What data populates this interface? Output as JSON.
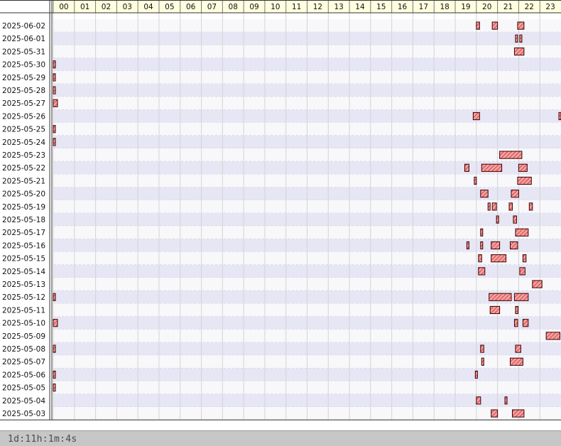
{
  "footer": {
    "duration": "1d:11h:1m:4s"
  },
  "chart_data": {
    "type": "gantt",
    "x_unit": "hour of day",
    "xlim": [
      0,
      24
    ],
    "hours": [
      "00",
      "01",
      "02",
      "03",
      "04",
      "05",
      "06",
      "07",
      "08",
      "09",
      "10",
      "11",
      "12",
      "13",
      "14",
      "15",
      "16",
      "17",
      "18",
      "19",
      "20",
      "21",
      "22",
      "23"
    ],
    "colors": {
      "bar_fill": "#e06060",
      "bar_stroke": "#3a0000",
      "header_bg": "#ffffe0",
      "row_alt": "#e6e6f4",
      "row_base": "#f8f8fb"
    },
    "rows": [
      {
        "date": "2025-06-02",
        "bars": [
          [
            20.0,
            20.15
          ],
          [
            20.75,
            21.0
          ],
          [
            21.95,
            22.25
          ]
        ]
      },
      {
        "date": "2025-06-01",
        "bars": [
          [
            21.85,
            21.95
          ],
          [
            22.05,
            22.15
          ]
        ]
      },
      {
        "date": "2025-05-31",
        "bars": [
          [
            21.8,
            22.25
          ]
        ]
      },
      {
        "date": "2025-05-30",
        "bars": [
          [
            0.0,
            0.1
          ]
        ]
      },
      {
        "date": "2025-05-29",
        "bars": [
          [
            0.0,
            0.1
          ]
        ]
      },
      {
        "date": "2025-05-28",
        "bars": [
          [
            0.0,
            0.1
          ]
        ]
      },
      {
        "date": "2025-05-27",
        "bars": [
          [
            0.0,
            0.2
          ]
        ]
      },
      {
        "date": "2025-05-26",
        "bars": [
          [
            19.85,
            20.15
          ],
          [
            23.9,
            24.0
          ]
        ]
      },
      {
        "date": "2025-05-25",
        "bars": [
          [
            0.0,
            0.1
          ]
        ]
      },
      {
        "date": "2025-05-24",
        "bars": [
          [
            0.0,
            0.1
          ]
        ]
      },
      {
        "date": "2025-05-23",
        "bars": [
          [
            21.1,
            22.15
          ]
        ]
      },
      {
        "date": "2025-05-22",
        "bars": [
          [
            19.45,
            19.65
          ],
          [
            20.25,
            21.2
          ],
          [
            22.0,
            22.4
          ]
        ]
      },
      {
        "date": "2025-05-21",
        "bars": [
          [
            19.9,
            19.97
          ],
          [
            21.95,
            22.6
          ]
        ]
      },
      {
        "date": "2025-05-20",
        "bars": [
          [
            20.2,
            20.55
          ],
          [
            21.65,
            22.0
          ]
        ]
      },
      {
        "date": "2025-05-19",
        "bars": [
          [
            20.55,
            20.65
          ],
          [
            20.75,
            20.95
          ],
          [
            21.55,
            21.7
          ],
          [
            22.5,
            22.65
          ]
        ]
      },
      {
        "date": "2025-05-18",
        "bars": [
          [
            20.95,
            21.05
          ],
          [
            21.75,
            21.9
          ]
        ]
      },
      {
        "date": "2025-05-17",
        "bars": [
          [
            20.2,
            20.27
          ],
          [
            21.85,
            22.45
          ]
        ]
      },
      {
        "date": "2025-05-16",
        "bars": [
          [
            19.55,
            19.65
          ],
          [
            20.2,
            20.27
          ],
          [
            20.7,
            21.1
          ],
          [
            21.6,
            21.95
          ]
        ]
      },
      {
        "date": "2025-05-15",
        "bars": [
          [
            20.1,
            20.25
          ],
          [
            20.7,
            21.4
          ],
          [
            22.2,
            22.35
          ]
        ]
      },
      {
        "date": "2025-05-14",
        "bars": [
          [
            20.1,
            20.4
          ],
          [
            22.05,
            22.3
          ]
        ]
      },
      {
        "date": "2025-05-13",
        "bars": [
          [
            22.65,
            23.1
          ]
        ]
      },
      {
        "date": "2025-05-12",
        "bars": [
          [
            0.0,
            0.1
          ],
          [
            20.6,
            21.65
          ],
          [
            21.8,
            22.45
          ]
        ]
      },
      {
        "date": "2025-05-11",
        "bars": [
          [
            20.65,
            21.1
          ],
          [
            21.85,
            21.97
          ]
        ]
      },
      {
        "date": "2025-05-10",
        "bars": [
          [
            0.0,
            0.2
          ],
          [
            21.8,
            21.95
          ],
          [
            22.2,
            22.45
          ]
        ]
      },
      {
        "date": "2025-05-09",
        "bars": [
          [
            23.3,
            23.95
          ]
        ]
      },
      {
        "date": "2025-05-08",
        "bars": [
          [
            0.0,
            0.1
          ],
          [
            20.2,
            20.35
          ],
          [
            21.85,
            22.1
          ]
        ]
      },
      {
        "date": "2025-05-07",
        "bars": [
          [
            20.25,
            20.32
          ],
          [
            21.6,
            22.2
          ]
        ]
      },
      {
        "date": "2025-05-06",
        "bars": [
          [
            0.0,
            0.1
          ],
          [
            19.95,
            20.05
          ]
        ]
      },
      {
        "date": "2025-05-05",
        "bars": [
          [
            0.0,
            0.1
          ]
        ]
      },
      {
        "date": "2025-05-04",
        "bars": [
          [
            20.0,
            20.2
          ],
          [
            21.35,
            21.45
          ]
        ]
      },
      {
        "date": "2025-05-03",
        "bars": [
          [
            20.7,
            21.0
          ],
          [
            21.7,
            22.25
          ]
        ]
      }
    ]
  }
}
